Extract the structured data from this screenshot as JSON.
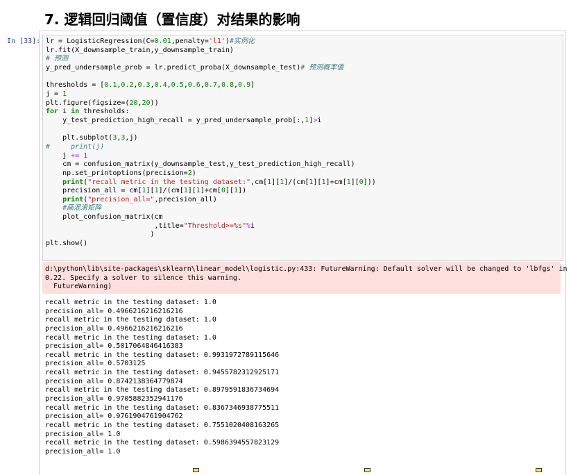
{
  "heading": "7. 逻辑回归阈值（置信度）对结果的影响",
  "cell": {
    "prompt": "In [33]:",
    "code_lines": [
      [
        {
          "t": "lr = LogisticRegression(C="
        },
        {
          "t": "0.01",
          "c": "num"
        },
        {
          "t": ",penalty="
        },
        {
          "t": "'l1'",
          "c": "str"
        },
        {
          "t": ")"
        },
        {
          "t": "#实例化",
          "c": "com"
        }
      ],
      [
        {
          "t": "lr.fit(X_downsample_train,y_downsample_train)"
        }
      ],
      [
        {
          "t": "# 预测",
          "c": "com"
        }
      ],
      [
        {
          "t": "y_pred_undersample_prob = lr.predict_proba(X_downsample_test)"
        },
        {
          "t": "# 预测概率值",
          "c": "com"
        }
      ],
      [
        {
          "t": ""
        }
      ],
      [
        {
          "t": "thresholds = ["
        },
        {
          "t": "0.1",
          "c": "num"
        },
        {
          "t": ","
        },
        {
          "t": "0.2",
          "c": "num"
        },
        {
          "t": ","
        },
        {
          "t": "0.3",
          "c": "num"
        },
        {
          "t": ","
        },
        {
          "t": "0.4",
          "c": "num"
        },
        {
          "t": ","
        },
        {
          "t": "0.5",
          "c": "num"
        },
        {
          "t": ","
        },
        {
          "t": "0.6",
          "c": "num"
        },
        {
          "t": ","
        },
        {
          "t": "0.7",
          "c": "num"
        },
        {
          "t": ","
        },
        {
          "t": "0.8",
          "c": "num"
        },
        {
          "t": ","
        },
        {
          "t": "0.9",
          "c": "num"
        },
        {
          "t": "]"
        }
      ],
      [
        {
          "t": "j = "
        },
        {
          "t": "1",
          "c": "num"
        }
      ],
      [
        {
          "t": "plt.figure(figsize=("
        },
        {
          "t": "20",
          "c": "num"
        },
        {
          "t": ","
        },
        {
          "t": "20",
          "c": "num"
        },
        {
          "t": "))"
        }
      ],
      [
        {
          "t": "for",
          "c": "kw"
        },
        {
          "t": " i "
        },
        {
          "t": "in",
          "c": "kw"
        },
        {
          "t": " thresholds:"
        }
      ],
      [
        {
          "t": "    y_test_prediction_high_recall = y_pred_undersample_prob[:,"
        },
        {
          "t": "1",
          "c": "num"
        },
        {
          "t": "]"
        },
        {
          "t": ">",
          "c": "op"
        },
        {
          "t": "i"
        }
      ],
      [
        {
          "t": ""
        }
      ],
      [
        {
          "t": "    plt.subplot("
        },
        {
          "t": "3",
          "c": "num"
        },
        {
          "t": ","
        },
        {
          "t": "3",
          "c": "num"
        },
        {
          "t": ",j)"
        }
      ],
      [
        {
          "t": "#     print(j)",
          "c": "com"
        }
      ],
      [
        {
          "t": "    j "
        },
        {
          "t": "+=",
          "c": "op"
        },
        {
          "t": " "
        },
        {
          "t": "1",
          "c": "num"
        }
      ],
      [
        {
          "t": "    cm = confusion_matrix(y_downsample_test,y_test_prediction_high_recall)"
        }
      ],
      [
        {
          "t": "    np.set_printoptions(precision="
        },
        {
          "t": "2",
          "c": "num"
        },
        {
          "t": ")"
        }
      ],
      [
        {
          "t": "    "
        },
        {
          "t": "print",
          "c": "kw"
        },
        {
          "t": "("
        },
        {
          "t": "\"recall metric in the testing dataset:\"",
          "c": "str"
        },
        {
          "t": ",cm["
        },
        {
          "t": "1",
          "c": "num"
        },
        {
          "t": "]["
        },
        {
          "t": "1",
          "c": "num"
        },
        {
          "t": "]/(cm["
        },
        {
          "t": "1",
          "c": "num"
        },
        {
          "t": "]["
        },
        {
          "t": "1",
          "c": "num"
        },
        {
          "t": "]+cm["
        },
        {
          "t": "1",
          "c": "num"
        },
        {
          "t": "]["
        },
        {
          "t": "0",
          "c": "num"
        },
        {
          "t": "]))"
        }
      ],
      [
        {
          "t": "    precision_all = cm["
        },
        {
          "t": "1",
          "c": "num"
        },
        {
          "t": "]["
        },
        {
          "t": "1",
          "c": "num"
        },
        {
          "t": "]/(cm["
        },
        {
          "t": "1",
          "c": "num"
        },
        {
          "t": "]["
        },
        {
          "t": "1",
          "c": "num"
        },
        {
          "t": "]+cm["
        },
        {
          "t": "0",
          "c": "num"
        },
        {
          "t": "]["
        },
        {
          "t": "1",
          "c": "num"
        },
        {
          "t": "])"
        }
      ],
      [
        {
          "t": "    "
        },
        {
          "t": "print",
          "c": "kw"
        },
        {
          "t": "("
        },
        {
          "t": "\"precision_all=\"",
          "c": "str"
        },
        {
          "t": ",precision_all)"
        }
      ],
      [
        {
          "t": "    "
        },
        {
          "t": "#画混淆矩阵",
          "c": "com"
        }
      ],
      [
        {
          "t": "    plot_confusion_matrix(cm"
        }
      ],
      [
        {
          "t": "                          ,title="
        },
        {
          "t": "\"Threshold>=%s\"",
          "c": "str"
        },
        {
          "t": "%",
          "c": "op"
        },
        {
          "t": "i"
        }
      ],
      [
        {
          "t": "                         )"
        }
      ],
      [
        {
          "t": "plt.show()"
        }
      ]
    ],
    "stderr": "d:\\python\\lib\\site-packages\\sklearn\\linear_model\\logistic.py:433: FutureWarning: Default solver will be changed to 'lbfgs' in\n0.22. Specify a solver to silence this warning.\n  FutureWarning)",
    "stdout_lines": [
      "recall metric in the testing dataset: 1.0",
      "precision_all= 0.4966216216216216",
      "recall metric in the testing dataset: 1.0",
      "precision_all= 0.4966216216216216",
      "recall metric in the testing dataset: 1.0",
      "precision_all= 0.5017064846416383",
      "recall metric in the testing dataset: 0.9931972789115646",
      "precision_all= 0.5703125",
      "recall metric in the testing dataset: 0.9455782312925171",
      "precision_all= 0.8742138364779874",
      "recall metric in the testing dataset: 0.8979591836734694",
      "precision_all= 0.9705882352941176",
      "recall metric in the testing dataset: 0.8367346938775511",
      "precision_all= 0.9761904761904762",
      "recall metric in the testing dataset: 0.7551020408163265",
      "precision_all= 1.0",
      "recall metric in the testing dataset: 0.5986394557823129",
      "precision_all= 1.0"
    ]
  },
  "colors": {
    "prompt": "#303f9f",
    "code_bg": "#f7f7f7",
    "stderr_bg": "#fddfdd",
    "keyword": "#008000",
    "string": "#ba2121",
    "comment": "#408080"
  }
}
